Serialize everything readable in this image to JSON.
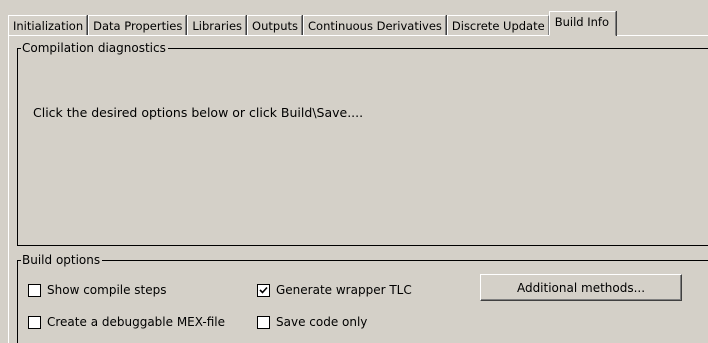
{
  "tabs": [
    {
      "label": "Initialization",
      "selected": false
    },
    {
      "label": "Data Properties",
      "selected": false
    },
    {
      "label": "Libraries",
      "selected": false
    },
    {
      "label": "Outputs",
      "selected": false
    },
    {
      "label": "Continuous Derivatives",
      "selected": false
    },
    {
      "label": "Discrete Update",
      "selected": false
    },
    {
      "label": "Build Info",
      "selected": true
    }
  ],
  "diagnostics": {
    "title": "Compilation diagnostics",
    "message": "Click the desired options below or click Build\\Save...."
  },
  "build_options": {
    "title": "Build options",
    "show_compile_steps": {
      "label": "Show compile steps",
      "checked": false
    },
    "generate_wrapper_tlc": {
      "label": "Generate wrapper TLC",
      "checked": true
    },
    "create_debuggable_mex": {
      "label": "Create a debuggable MEX-file",
      "checked": false
    },
    "save_code_only": {
      "label": "Save code only",
      "checked": false
    },
    "additional_methods_label": "Additional methods..."
  }
}
